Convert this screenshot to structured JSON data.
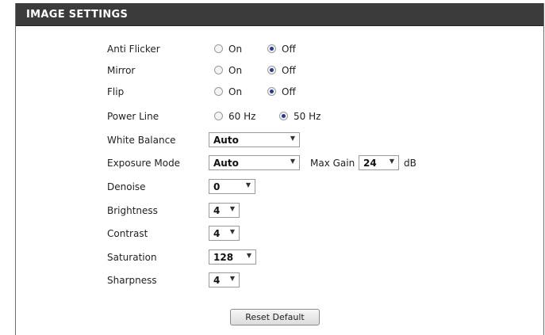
{
  "header": {
    "title": "IMAGE SETTINGS"
  },
  "settings": {
    "anti_flicker": {
      "label": "Anti Flicker",
      "opt1": "On",
      "opt2": "Off",
      "selected": "Off"
    },
    "mirror": {
      "label": "Mirror",
      "opt1": "On",
      "opt2": "Off",
      "selected": "Off"
    },
    "flip": {
      "label": "Flip",
      "opt1": "On",
      "opt2": "Off",
      "selected": "Off"
    },
    "power_line": {
      "label": "Power Line",
      "opt1": "60 Hz",
      "opt2": "50 Hz",
      "selected": "50 Hz"
    },
    "white_balance": {
      "label": "White Balance",
      "value": "Auto"
    },
    "exposure_mode": {
      "label": "Exposure Mode",
      "value": "Auto",
      "max_gain_label": "Max Gain",
      "max_gain_value": "24",
      "unit": "dB"
    },
    "denoise": {
      "label": "Denoise",
      "value": "0"
    },
    "brightness": {
      "label": "Brightness",
      "value": "4"
    },
    "contrast": {
      "label": "Contrast",
      "value": "4"
    },
    "saturation": {
      "label": "Saturation",
      "value": "128"
    },
    "sharpness": {
      "label": "Sharpness",
      "value": "4"
    }
  },
  "actions": {
    "reset_label": "Reset Default"
  },
  "icons": {
    "dropdown": "chevron-down-icon"
  },
  "colors": {
    "header_bg": "#3b3b3b",
    "radio_dot": "#2a3a8a"
  }
}
